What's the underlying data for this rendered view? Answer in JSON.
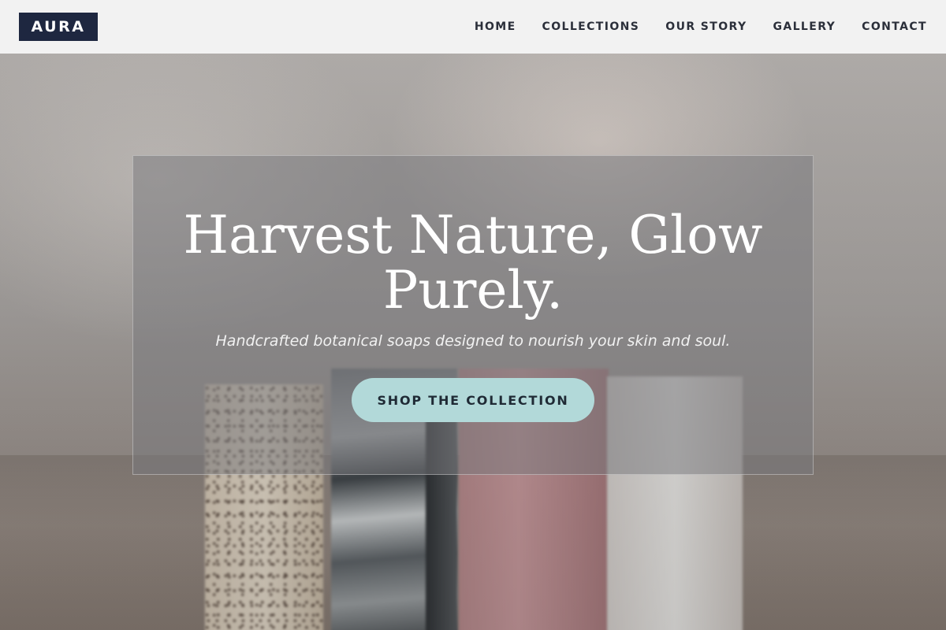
{
  "brand": {
    "logo_text": "AURA"
  },
  "nav": {
    "items": [
      {
        "label": "HOME"
      },
      {
        "label": "COLLECTIONS"
      },
      {
        "label": "OUR STORY"
      },
      {
        "label": "GALLERY"
      },
      {
        "label": "CONTACT"
      }
    ]
  },
  "hero": {
    "title": "Harvest Nature, Glow Purely.",
    "subtitle": "Handcrafted botanical soaps designed to nourish your skin and soul.",
    "cta_label": "SHOP THE COLLECTION"
  },
  "colors": {
    "header_bg": "#f2f2f2",
    "logo_bg": "#1e2740",
    "nav_text": "#2b2f3a",
    "cta_bg": "#b2d9d9",
    "cta_text": "#1f2a35",
    "hero_text": "#ffffff"
  }
}
